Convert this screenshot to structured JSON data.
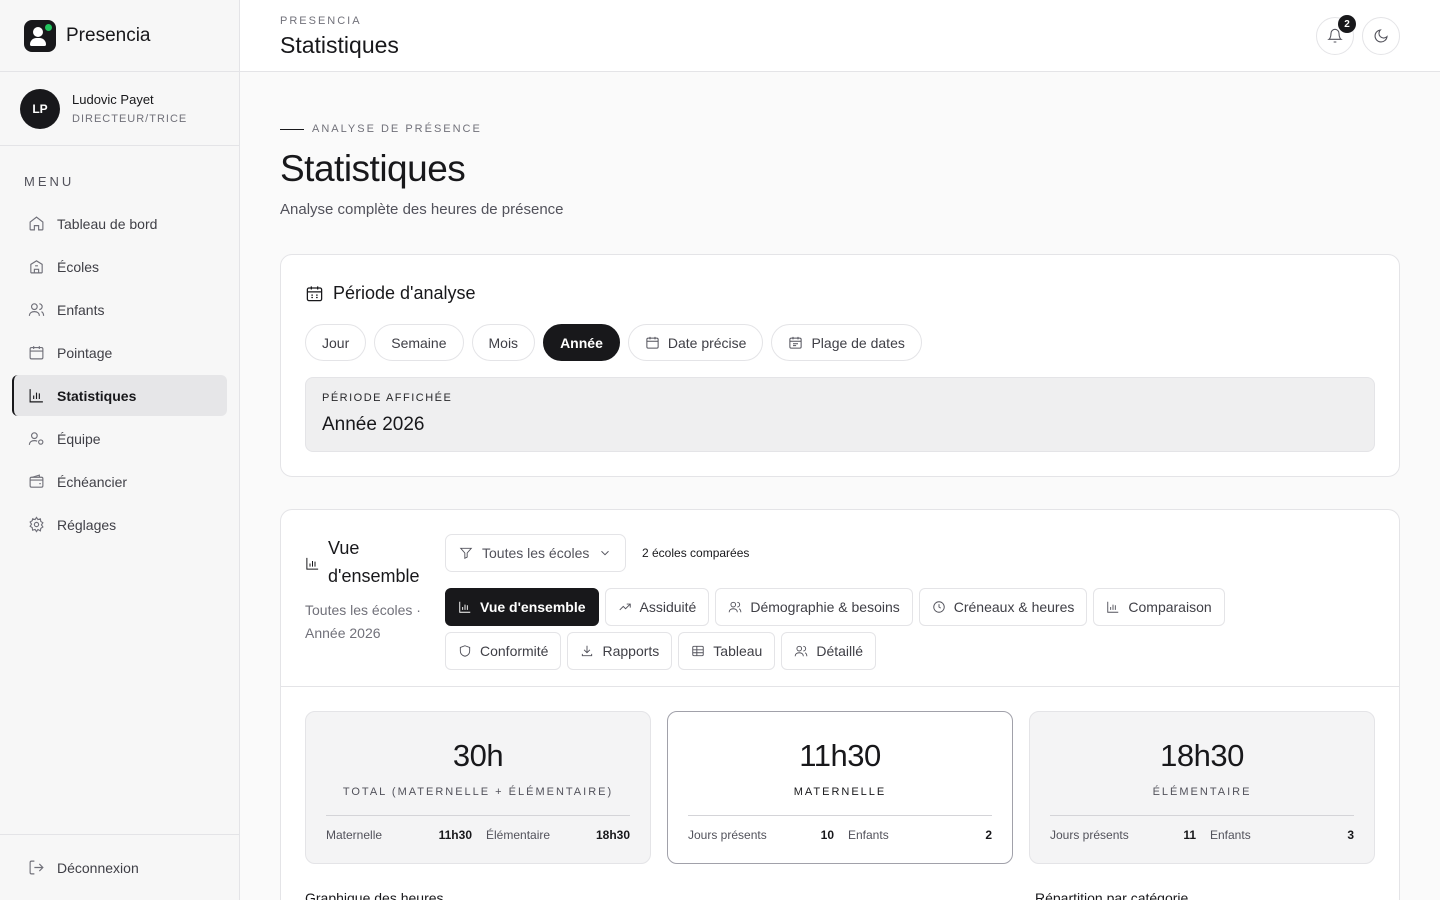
{
  "app": {
    "name": "Presencia"
  },
  "user": {
    "initials": "LP",
    "name": "Ludovic Payet",
    "role": "DIRECTEUR/TRICE"
  },
  "sidebar": {
    "menu_label": "MENU",
    "items": [
      {
        "label": "Tableau de bord",
        "icon": "home-icon"
      },
      {
        "label": "Écoles",
        "icon": "school-icon"
      },
      {
        "label": "Enfants",
        "icon": "users-icon"
      },
      {
        "label": "Pointage",
        "icon": "calendar-icon"
      },
      {
        "label": "Statistiques",
        "icon": "bar-chart-icon",
        "active": true
      },
      {
        "label": "Équipe",
        "icon": "user-cog-icon"
      },
      {
        "label": "Échéancier",
        "icon": "wallet-icon"
      },
      {
        "label": "Réglages",
        "icon": "gear-icon"
      }
    ],
    "logout": "Déconnexion"
  },
  "topbar": {
    "kicker": "PRESENCIA",
    "title": "Statistiques",
    "notifications": "2"
  },
  "page": {
    "kicker": "ANALYSE DE PRÉSENCE",
    "title": "Statistiques",
    "subtitle": "Analyse complète des heures de présence"
  },
  "period": {
    "title": "Période d'analyse",
    "options": [
      "Jour",
      "Semaine",
      "Mois",
      "Année",
      "Date précise",
      "Plage de dates"
    ],
    "selected": "Année",
    "display_label": "PÉRIODE AFFICHÉE",
    "display_value": "Année 2026"
  },
  "overview": {
    "title": "Vue d'ensemble",
    "subtitle": "Toutes les écoles · Année 2026",
    "filter": "Toutes les écoles",
    "compared": "2 écoles comparées",
    "tabs": [
      "Vue d'ensemble",
      "Assiduité",
      "Démographie & besoins",
      "Créneaux & heures",
      "Comparaison",
      "Conformité",
      "Rapports",
      "Tableau",
      "Détaillé"
    ],
    "active_tab": "Vue d'ensemble"
  },
  "stats": {
    "total": {
      "value": "30h",
      "label": "TOTAL (MATERNELLE + ÉLÉMENTAIRE)",
      "k1": "Maternelle",
      "v1": "11h30",
      "k2": "Élémentaire",
      "v2": "18h30"
    },
    "maternelle": {
      "value": "11h30",
      "label": "MATERNELLE",
      "k1": "Jours présents",
      "v1": "10",
      "k2": "Enfants",
      "v2": "2"
    },
    "elementaire": {
      "value": "18h30",
      "label": "ÉLÉMENTAIRE",
      "k1": "Jours présents",
      "v1": "11",
      "k2": "Enfants",
      "v2": "3"
    }
  },
  "below": {
    "chart_title": "Graphique des heures",
    "category_title": "Répartition par catégorie"
  }
}
